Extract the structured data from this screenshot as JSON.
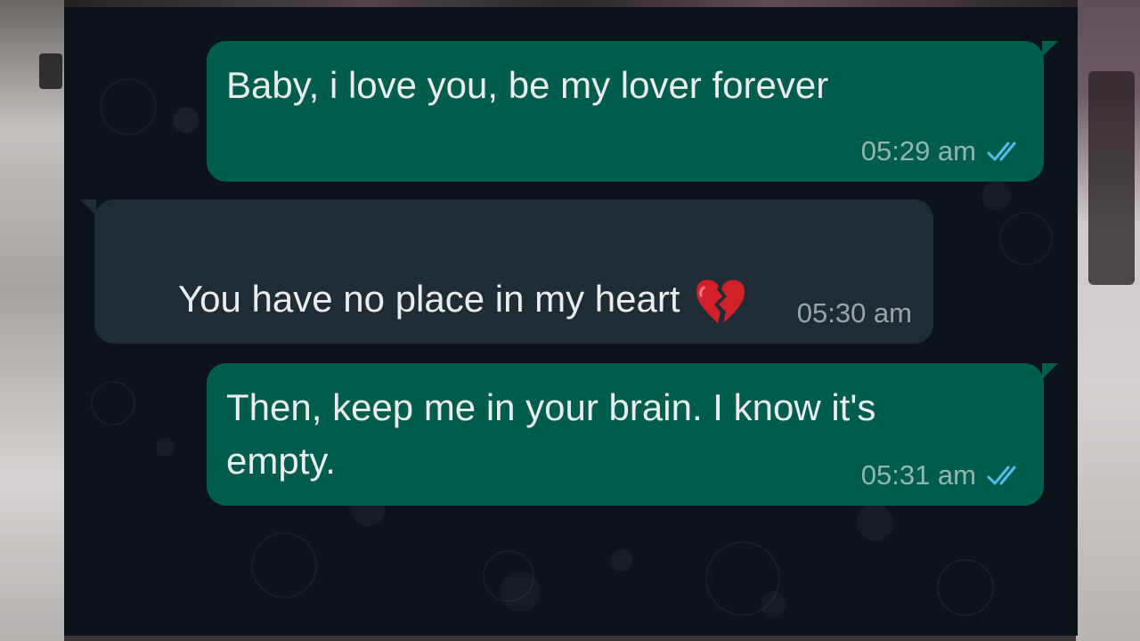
{
  "chat": {
    "messages": [
      {
        "direction": "outgoing",
        "text": "Baby, i love you, be my lover forever",
        "time": "05:29 am",
        "status_icon": "double-check-read-icon"
      },
      {
        "direction": "incoming",
        "text": "You have no place in my heart",
        "emoji": "broken-heart-icon",
        "time": "05:30 am"
      },
      {
        "direction": "outgoing",
        "text": "Then, keep me in your brain. I know it's\nempty.",
        "time": "05:31 am",
        "status_icon": "double-check-read-icon"
      }
    ]
  },
  "colors": {
    "chat_background": "#0b141a",
    "outgoing_bubble": "#005c4b",
    "incoming_bubble": "#202c33",
    "text": "#e9edef",
    "read_ticks": "#53bdeb",
    "emoji": "#d1202a"
  }
}
